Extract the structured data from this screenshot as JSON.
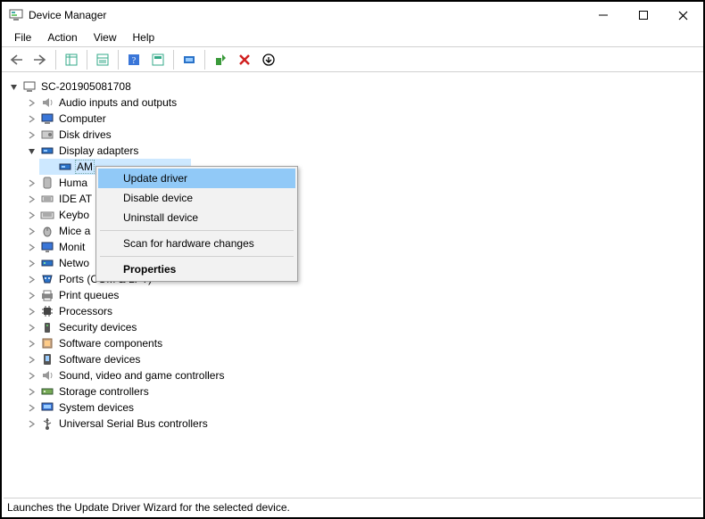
{
  "window": {
    "title": "Device Manager"
  },
  "menu": {
    "file": "File",
    "action": "Action",
    "view": "View",
    "help": "Help"
  },
  "tree": {
    "root": "SC-201905081708",
    "items": [
      "Audio inputs and outputs",
      "Computer",
      "Disk drives",
      "Display adapters",
      "AM",
      "Huma",
      "IDE AT",
      "Keybo",
      "Mice a",
      "Monit",
      "Netwo",
      "Ports (COM & LPT)",
      "Print queues",
      "Processors",
      "Security devices",
      "Software components",
      "Software devices",
      "Sound, video and game controllers",
      "Storage controllers",
      "System devices",
      "Universal Serial Bus controllers"
    ]
  },
  "context_menu": {
    "update": "Update driver",
    "disable": "Disable device",
    "uninstall": "Uninstall device",
    "scan": "Scan for hardware changes",
    "properties": "Properties"
  },
  "status": "Launches the Update Driver Wizard for the selected device."
}
